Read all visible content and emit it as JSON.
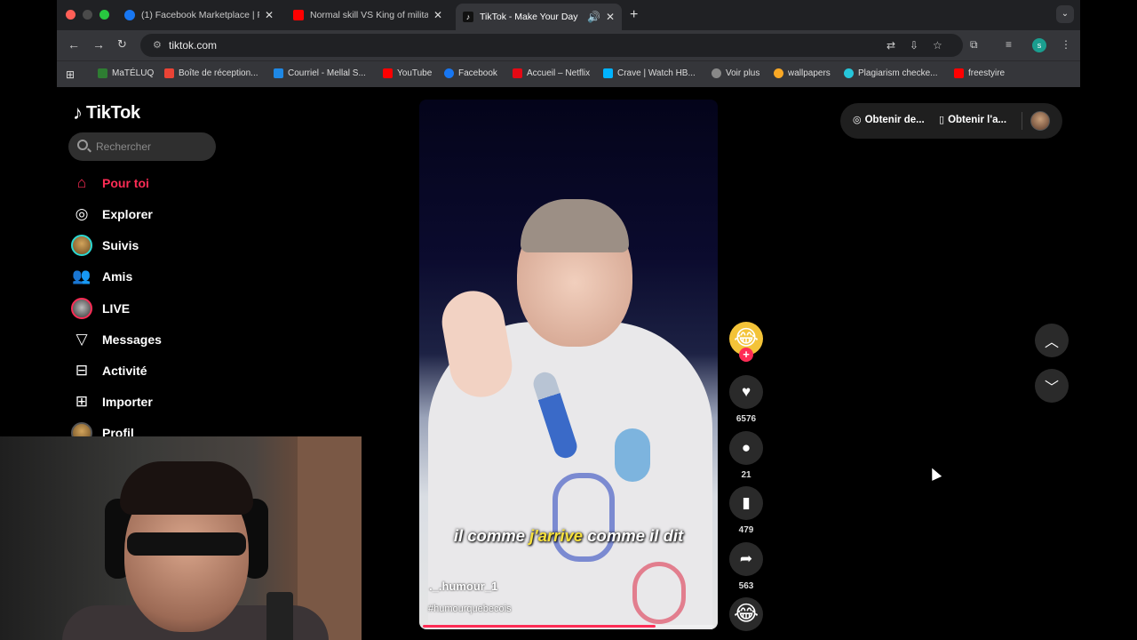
{
  "browser": {
    "tabs": [
      {
        "title": "(1) Facebook Marketplace | Fa",
        "favicon": "facebook-icon",
        "color": "#1877f2"
      },
      {
        "title": "Normal skill VS King of militar",
        "favicon": "youtube-icon",
        "color": "#ff0000"
      },
      {
        "title": "TikTok - Make Your Day",
        "favicon": "tiktok-icon",
        "color": "#000000",
        "active": true
      }
    ],
    "url": "tiktok.com",
    "profile_initial": "s",
    "bookmarks": [
      {
        "label": "MaTÉLUQ",
        "color": "#2e7d32"
      },
      {
        "label": "Boîte de réception...",
        "color": "#ea4335"
      },
      {
        "label": "Courriel - Mellal S...",
        "color": "#1e88e5"
      },
      {
        "label": "YouTube",
        "color": "#ff0000"
      },
      {
        "label": "Facebook",
        "color": "#1877f2"
      },
      {
        "label": "Accueil – Netflix",
        "color": "#e50914"
      },
      {
        "label": "Crave | Watch HB...",
        "color": "#00b3ff"
      },
      {
        "label": "Voir plus",
        "color": "#888888"
      },
      {
        "label": "wallpapers",
        "color": "#f9a825"
      },
      {
        "label": "Plagiarism checke...",
        "color": "#26c6da"
      },
      {
        "label": "freestyire",
        "color": "#ff0000"
      }
    ]
  },
  "tiktok": {
    "logo": "TikTok",
    "search_placeholder": "Rechercher",
    "nav": [
      {
        "label": "Pour toi",
        "icon": "home-icon",
        "active": true
      },
      {
        "label": "Explorer",
        "icon": "compass-icon"
      },
      {
        "label": "Suivis",
        "icon": "following-avatar"
      },
      {
        "label": "Amis",
        "icon": "friends-icon"
      },
      {
        "label": "LIVE",
        "icon": "live-avatar"
      },
      {
        "label": "Messages",
        "icon": "messages-icon"
      },
      {
        "label": "Activité",
        "icon": "activity-icon"
      },
      {
        "label": "Importer",
        "icon": "upload-icon"
      },
      {
        "label": "Profil",
        "icon": "profile-avatar"
      }
    ],
    "top_right": {
      "get_coins": "Obtenir de...",
      "get_app": "Obtenir l'a..."
    },
    "video": {
      "caption_pre": "il comme ",
      "caption_highlight": "j'arrive",
      "caption_post": " comme il dit",
      "author": "._.humour_1",
      "hashtag": "#humourquebecois",
      "progress": 0.8
    },
    "actions": {
      "likes": "6576",
      "comments": "21",
      "saves": "479",
      "shares": "563"
    },
    "accent": "#fe2c55"
  }
}
